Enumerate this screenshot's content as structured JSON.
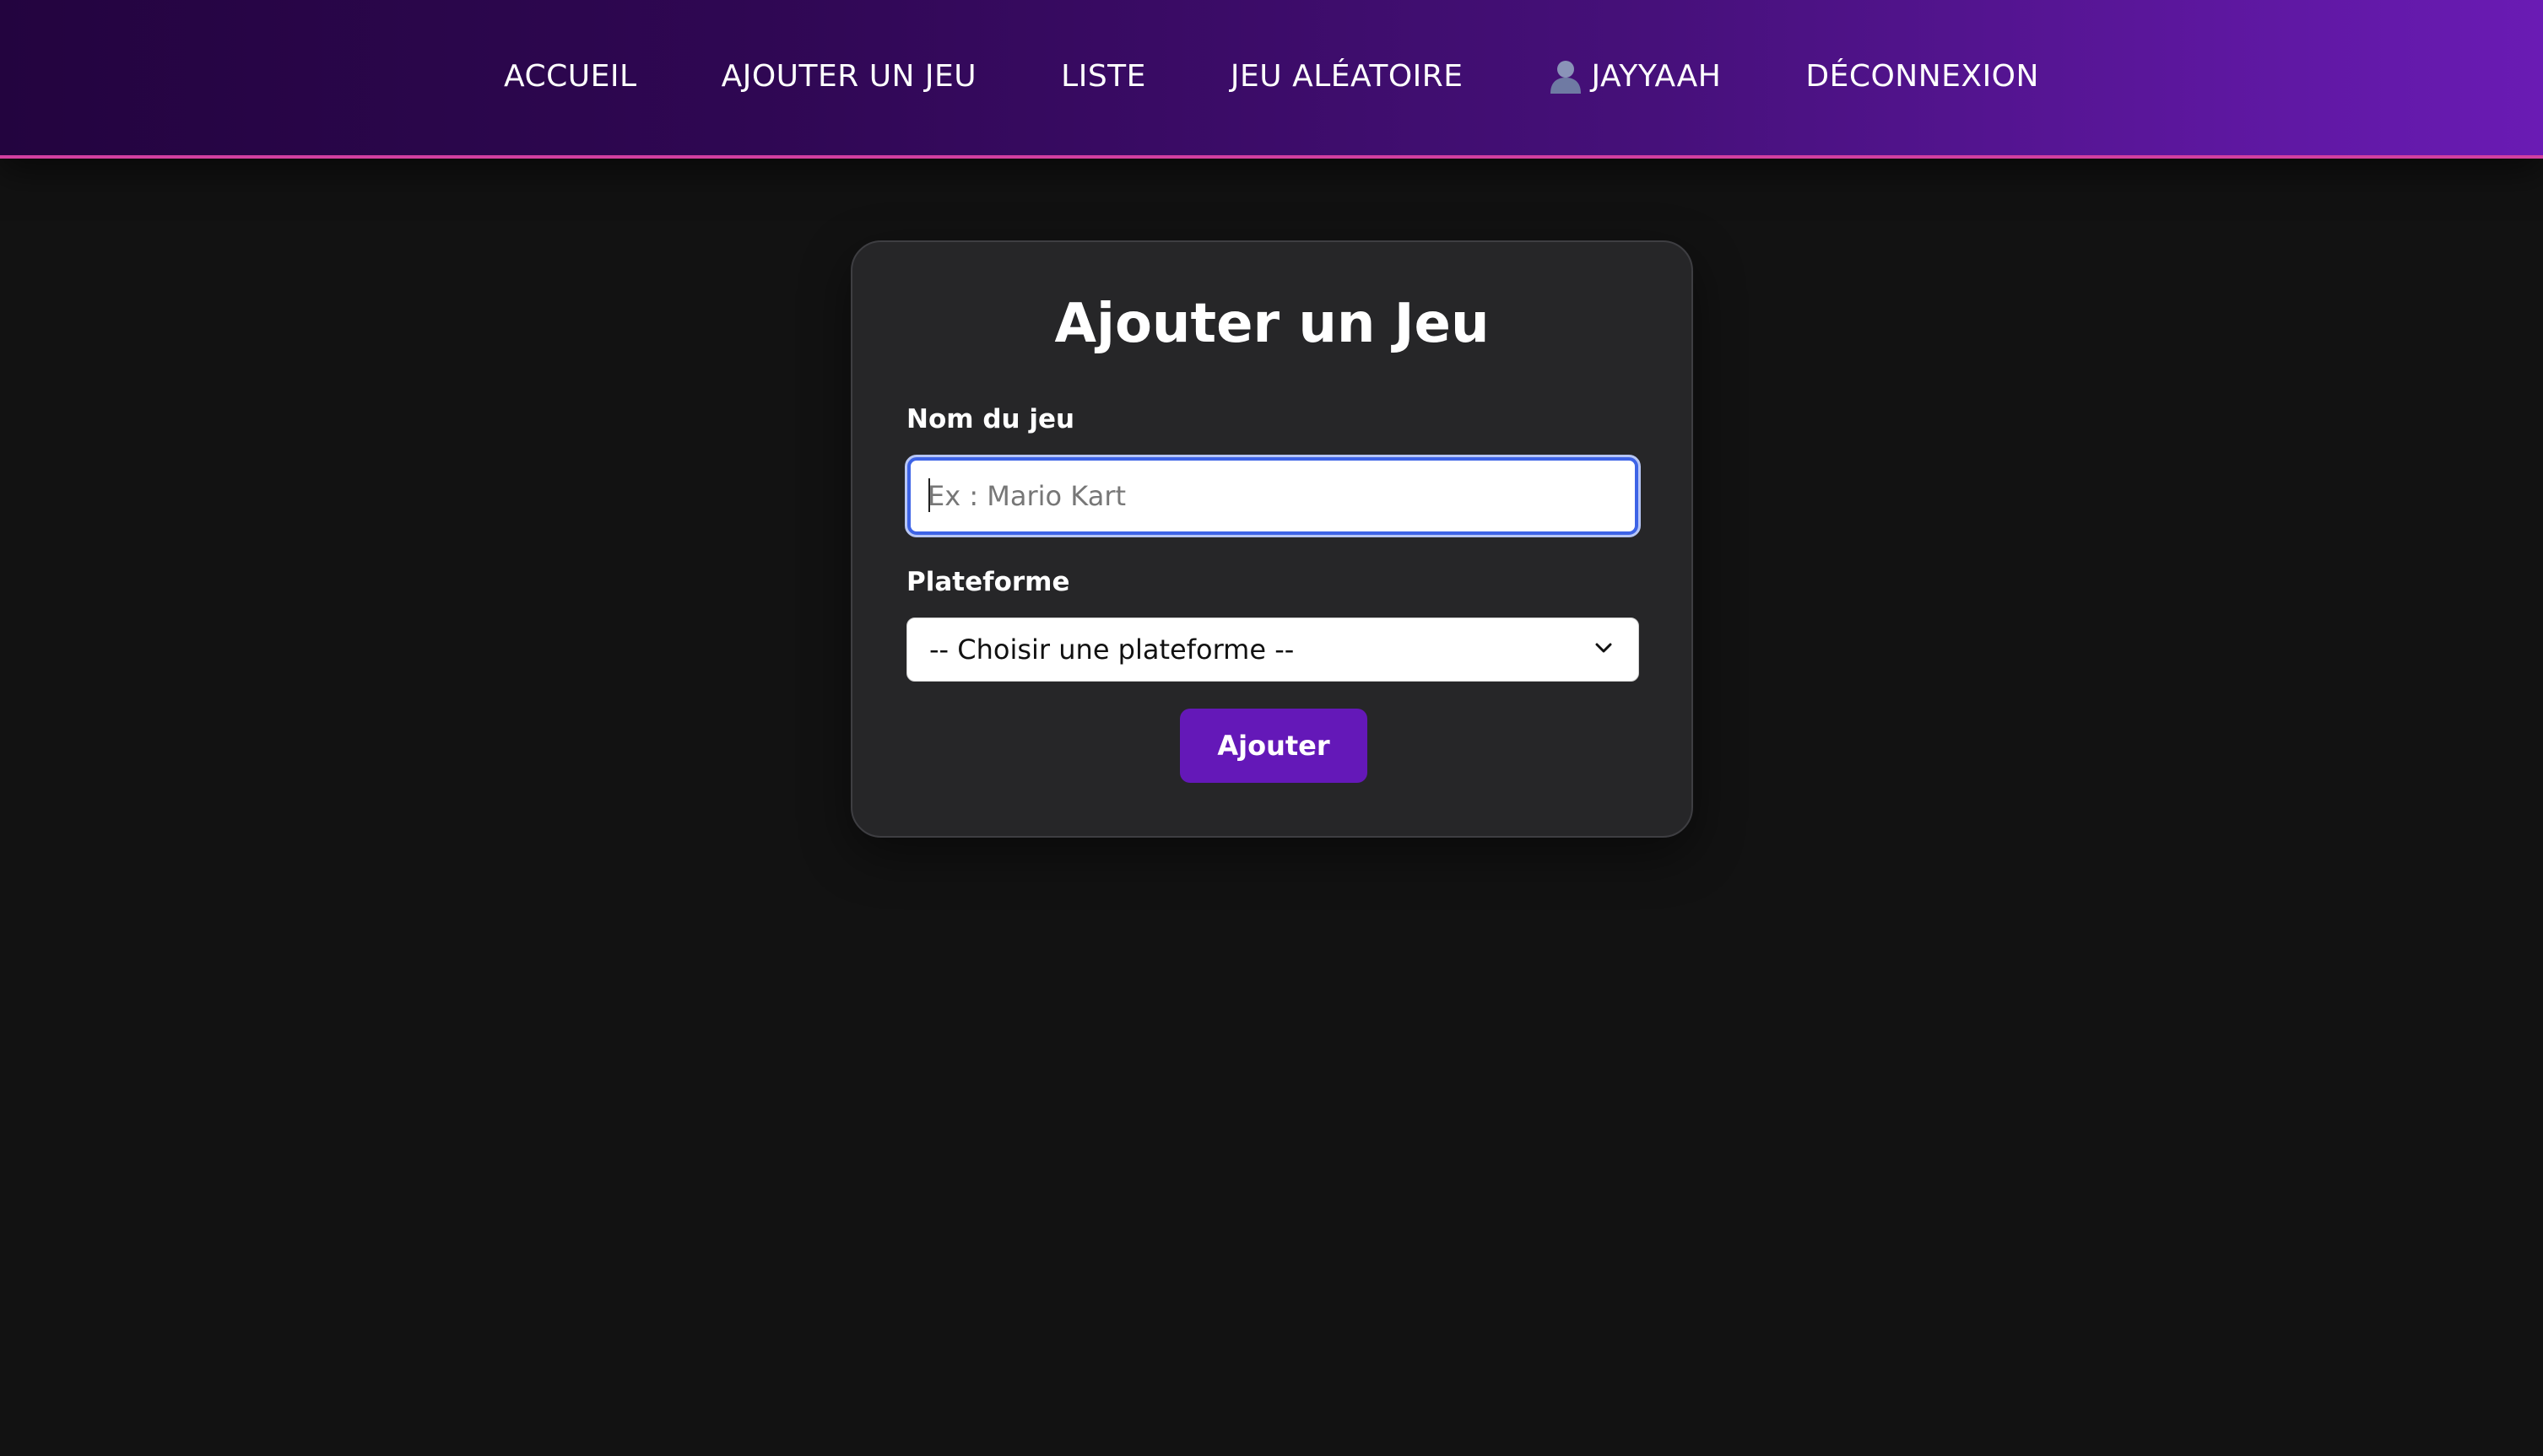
{
  "nav": {
    "items": [
      {
        "label": "ACCUEIL"
      },
      {
        "label": "AJOUTER UN JEU"
      },
      {
        "label": "LISTE"
      },
      {
        "label": "JEU ALÉATOIRE"
      },
      {
        "label": "JAYYAAH",
        "icon": "user-icon"
      },
      {
        "label": "DÉCONNEXION"
      }
    ]
  },
  "form": {
    "title": "Ajouter un Jeu",
    "name_label": "Nom du jeu",
    "name_value": "",
    "name_placeholder": "Ex : Mario Kart",
    "platform_label": "Plateforme",
    "platform_selected": "-- Choisir une plateforme --",
    "submit_label": "Ajouter"
  },
  "colors": {
    "nav_gradient_start": "#23043f",
    "nav_gradient_end": "#6a1bb4",
    "nav_border": "#d23fa0",
    "page_background": "#121212",
    "card_background": "#262628",
    "button": "#6418b8",
    "input_focus": "#3d63e6"
  }
}
